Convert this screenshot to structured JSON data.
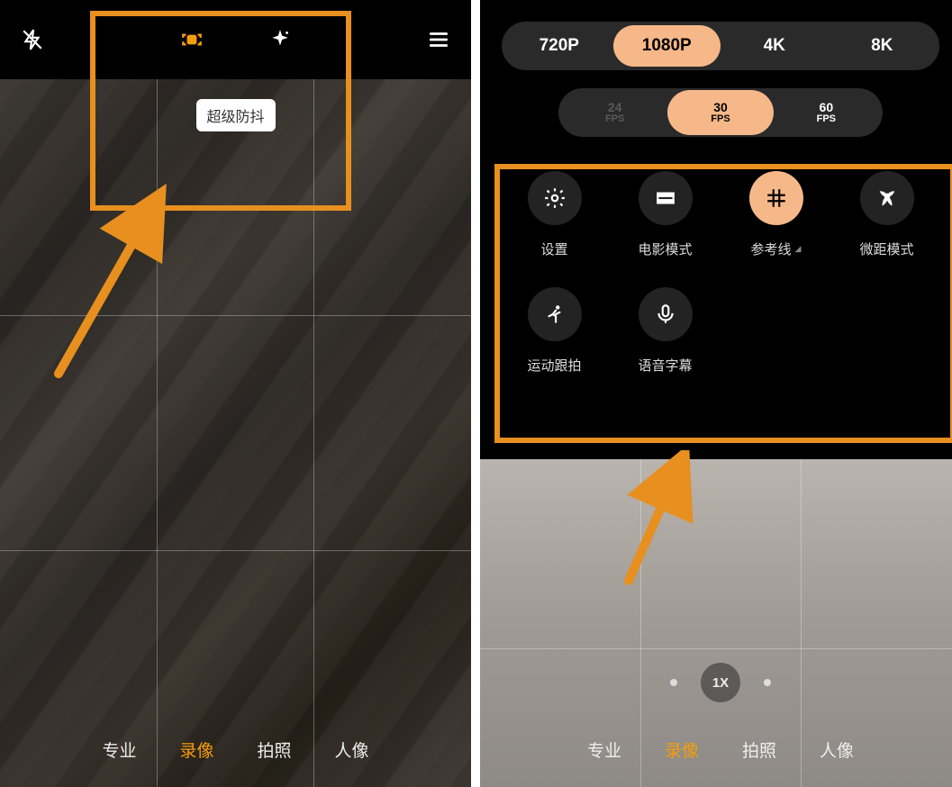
{
  "left": {
    "stabilization_chip": "超级防抖",
    "modes": [
      "专业",
      "录像",
      "拍照",
      "人像"
    ],
    "active_mode": "录像"
  },
  "right": {
    "resolutions": [
      "720P",
      "1080P",
      "4K",
      "8K"
    ],
    "resolution_selected": "1080P",
    "fps": [
      {
        "num": "24",
        "label": "FPS",
        "disabled": true
      },
      {
        "num": "30",
        "label": "FPS",
        "disabled": false,
        "selected": true
      },
      {
        "num": "60",
        "label": "FPS",
        "disabled": false
      }
    ],
    "options": [
      {
        "key": "settings",
        "label": "设置",
        "icon": "gear"
      },
      {
        "key": "cinema",
        "label": "电影模式",
        "icon": "rect"
      },
      {
        "key": "guidelines",
        "label": "参考线",
        "icon": "grid",
        "active": true,
        "caret": true
      },
      {
        "key": "macro",
        "label": "微距模式",
        "icon": "flower"
      },
      {
        "key": "tracking",
        "label": "运动跟拍",
        "icon": "runner"
      },
      {
        "key": "voice",
        "label": "语音字幕",
        "icon": "mic"
      }
    ],
    "zoom": "1X",
    "modes": [
      "专业",
      "录像",
      "拍照",
      "人像"
    ],
    "active_mode": "录像"
  },
  "icon_names": {
    "flash_off": "flash-off-icon",
    "stabilize": "stabilization-icon",
    "sparkle": "sparkle-icon",
    "menu": "menu-icon"
  }
}
